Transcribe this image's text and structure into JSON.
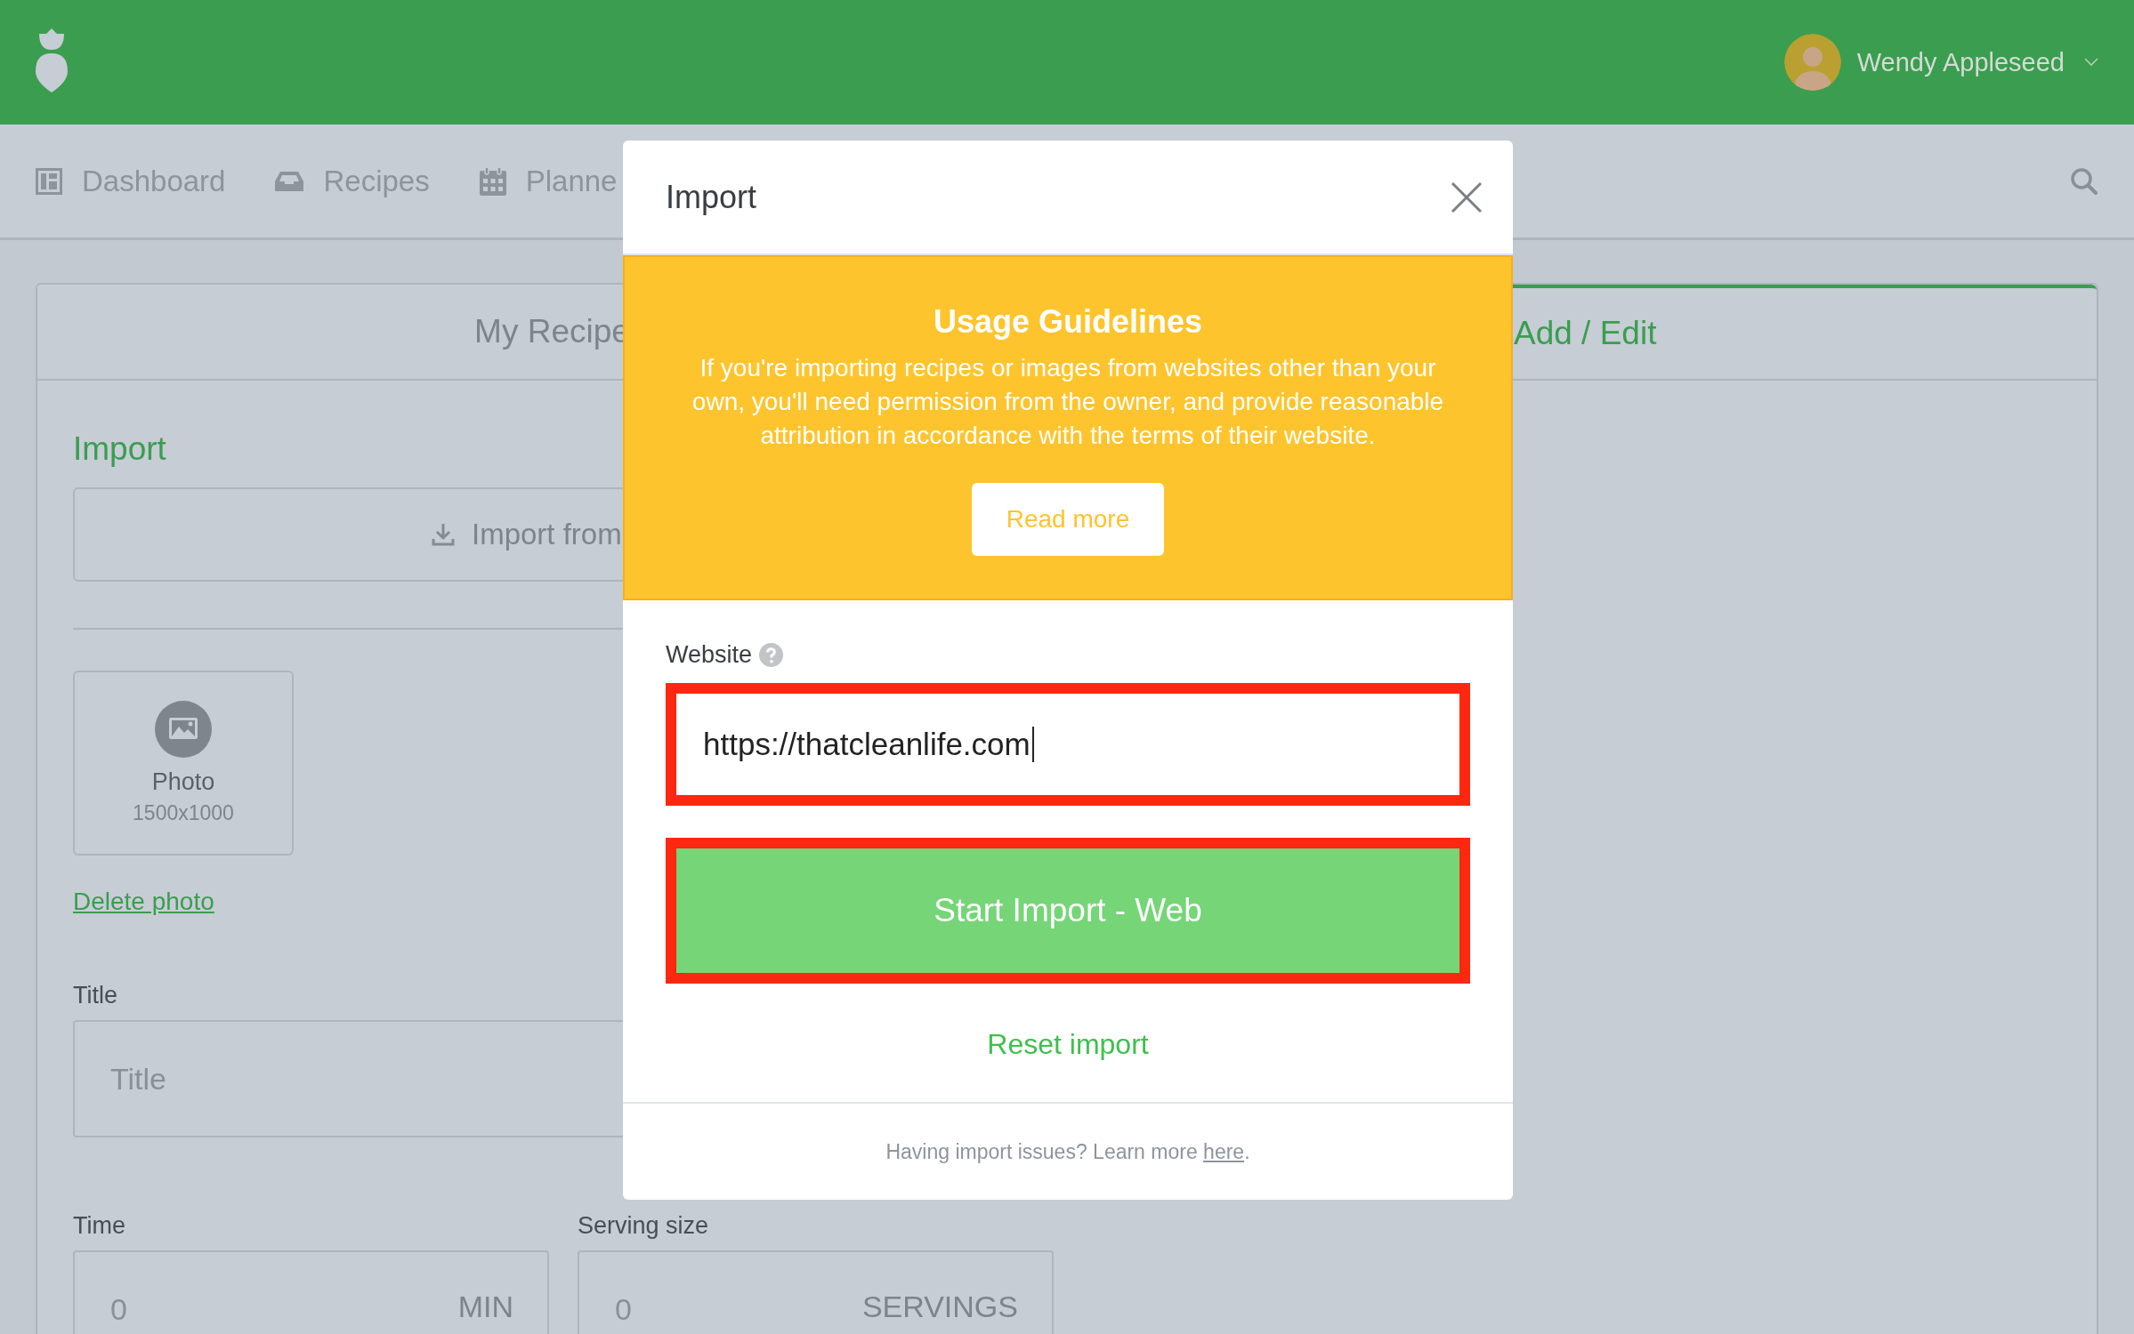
{
  "header": {
    "user_name": "Wendy Appleseed"
  },
  "nav": {
    "items": [
      {
        "label": "Dashboard",
        "kind": "dashboard"
      },
      {
        "label": "Recipes",
        "kind": "tray"
      },
      {
        "label": "Planne",
        "kind": "calendar"
      }
    ]
  },
  "tabs": [
    {
      "label": "My Recipe",
      "selected": false
    },
    {
      "label": "Add / Edit",
      "selected": true
    }
  ],
  "form": {
    "import_heading": "Import",
    "import_button": "Import from",
    "photo": {
      "label": "Photo",
      "size": "1500x1000"
    },
    "delete_link": "Delete photo",
    "title_field": {
      "label": "Title",
      "placeholder": "Title"
    },
    "time_field": {
      "label": "Time",
      "placeholder": "0",
      "unit": "MIN"
    },
    "serving_field": {
      "label": "Serving size",
      "placeholder": "0",
      "unit": "SERVINGS"
    }
  },
  "modal": {
    "title": "Import",
    "guidelines": {
      "title": "Usage Guidelines",
      "text": "If you're importing recipes or images from websites other than your own, you'll need permission from the owner, and provide reasonable attribution in accordance with the terms of their website.",
      "button": "Read more"
    },
    "website": {
      "label": "Website",
      "value": "https://thatcleanlife.com",
      "highlighted": true
    },
    "start_button": {
      "label": "Start Import - Web",
      "highlighted": true
    },
    "reset_link": "Reset import",
    "footer": {
      "text": "Having import issues? Learn more",
      "link": "here",
      "tail": "."
    }
  }
}
